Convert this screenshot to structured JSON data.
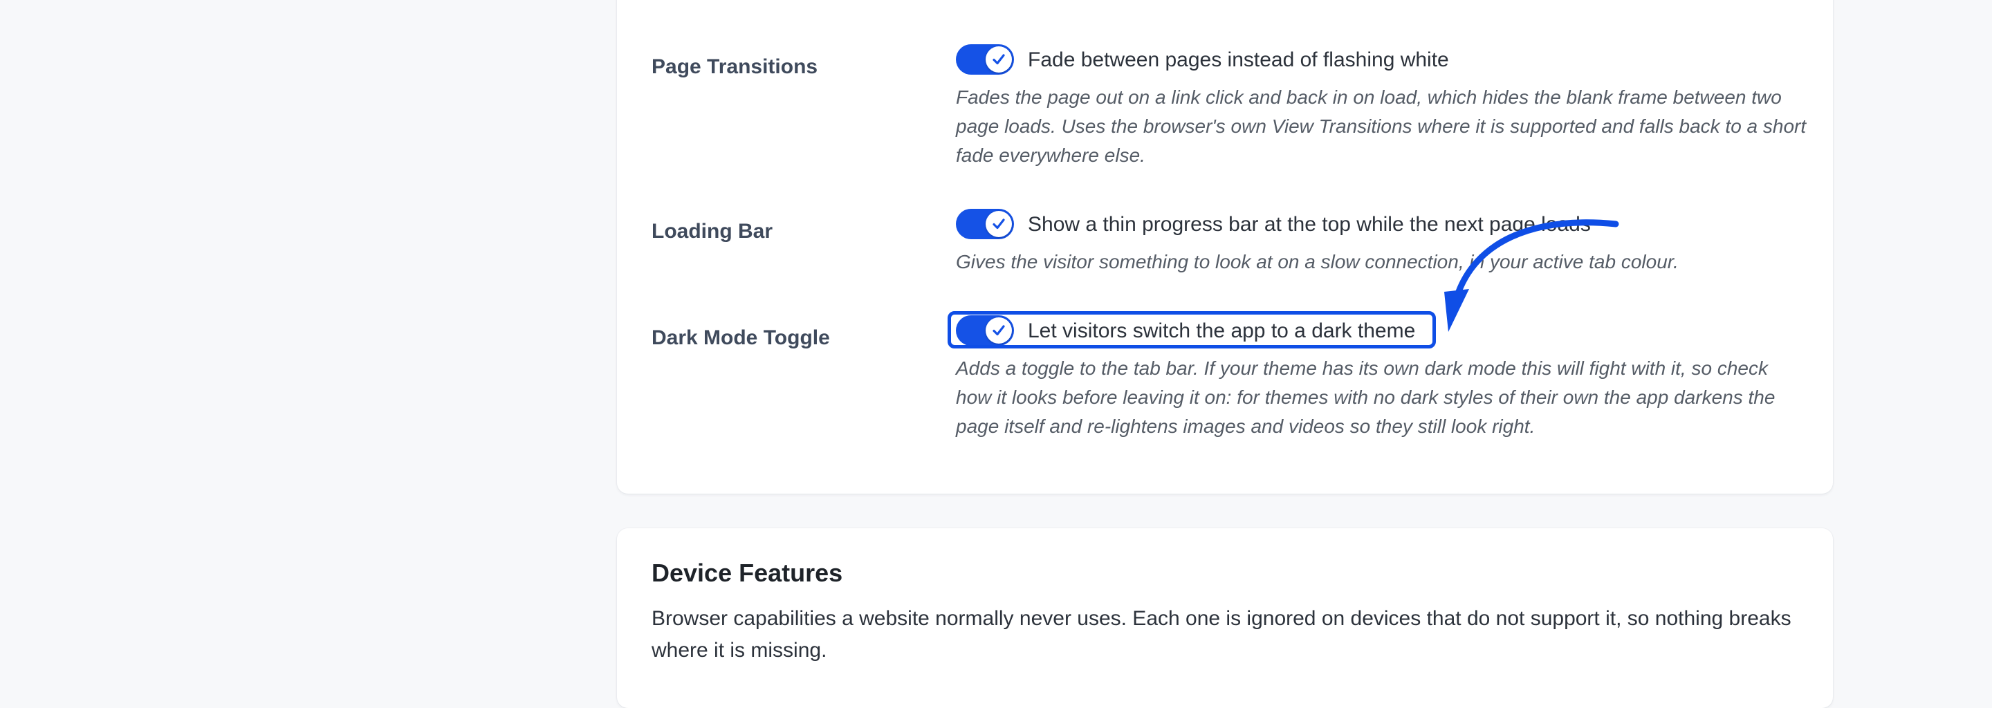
{
  "settings": {
    "clipped_text": "",
    "page_transitions": {
      "label": "Page Transitions",
      "enabled": true,
      "option": "Fade between pages instead of flashing white",
      "description": "Fades the page out on a link click and back in on load, which hides the blank frame between two page loads. Uses the browser's own View Transitions where it is supported and falls back to a short fade everywhere else."
    },
    "loading_bar": {
      "label": "Loading Bar",
      "enabled": true,
      "option": "Show a thin progress bar at the top while the next page loads",
      "description": "Gives the visitor something to look at on a slow connection, in your active tab colour."
    },
    "dark_mode_toggle": {
      "label": "Dark Mode Toggle",
      "enabled": true,
      "option": "Let visitors switch the app to a dark theme",
      "description": "Adds a toggle to the tab bar. If your theme has its own dark mode this will fight with it, so check how it looks before leaving it on: for themes with no dark styles of their own the app darkens the page itself and re-lightens images and videos so they still look right."
    }
  },
  "device_features": {
    "title": "Device Features",
    "description": "Browser capabilities a website normally never uses. Each one is ignored on devices that do not support it, so nothing breaks where it is missing."
  },
  "colors": {
    "accent": "#1552e6",
    "annotation": "#0f4ee6",
    "background": "#f7f8fa",
    "card": "#ffffff"
  },
  "icons": {
    "toggle_check": "check-icon",
    "annotation_arrow": "arrow-annotation-icon"
  }
}
